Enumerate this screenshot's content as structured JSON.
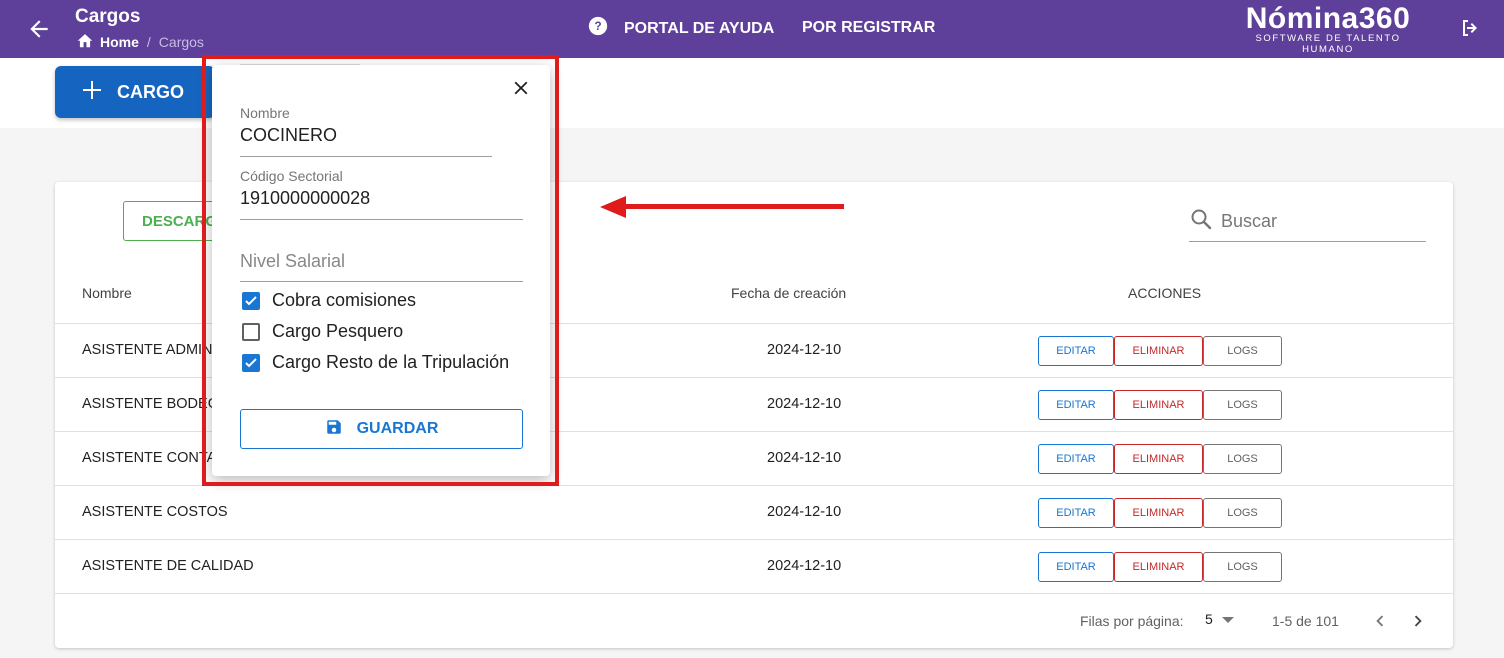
{
  "header": {
    "title": "Cargos",
    "breadcrumb_home": "Home",
    "breadcrumb_sep": "/",
    "breadcrumb_current": "Cargos",
    "nav_help": "PORTAL DE AYUDA",
    "nav_register": "POR REGISTRAR",
    "brand_name": "Nómina360",
    "brand_tagline": "SOFTWARE DE TALENTO HUMANO",
    "bg_color": "#5e3f9a"
  },
  "add_button": {
    "label": "CARGO",
    "icon": "plus-icon",
    "color": "#1565c0"
  },
  "toolbar": {
    "download_label": "DESCARGA",
    "search_placeholder": "Buscar"
  },
  "table": {
    "columns": {
      "name": "Nombre",
      "date": "Fecha de creación",
      "actions": "ACCIONES"
    },
    "rows": [
      {
        "name": "ASISTENTE ADMINIS",
        "date": "2024-12-10"
      },
      {
        "name": "ASISTENTE BODEGA",
        "date": "2024-12-10"
      },
      {
        "name": "ASISTENTE CONTAB",
        "date": "2024-12-10"
      },
      {
        "name": "ASISTENTE COSTOS",
        "date": "2024-12-10"
      },
      {
        "name": "ASISTENTE DE CALIDAD",
        "date": "2024-12-10"
      }
    ],
    "action_labels": {
      "edit": "EDITAR",
      "delete": "ELIMINAR",
      "logs": "LOGS"
    }
  },
  "pagination": {
    "rows_per_page_label": "Filas por página:",
    "rows_per_page": "5",
    "range": "1-5 de 101"
  },
  "dialog": {
    "nombre_label": "Nombre",
    "nombre_value": "COCINERO",
    "codigo_label": "Código Sectorial",
    "codigo_value": "1910000000028",
    "nivel_placeholder": "Nivel Salarial",
    "checkboxes": [
      {
        "label": "Cobra comisiones",
        "checked": true
      },
      {
        "label": "Cargo Pesquero",
        "checked": false
      },
      {
        "label": "Cargo Resto de la Tripulación",
        "checked": true
      }
    ],
    "save_label": "GUARDAR"
  },
  "annotation_color": "#e01b1b"
}
